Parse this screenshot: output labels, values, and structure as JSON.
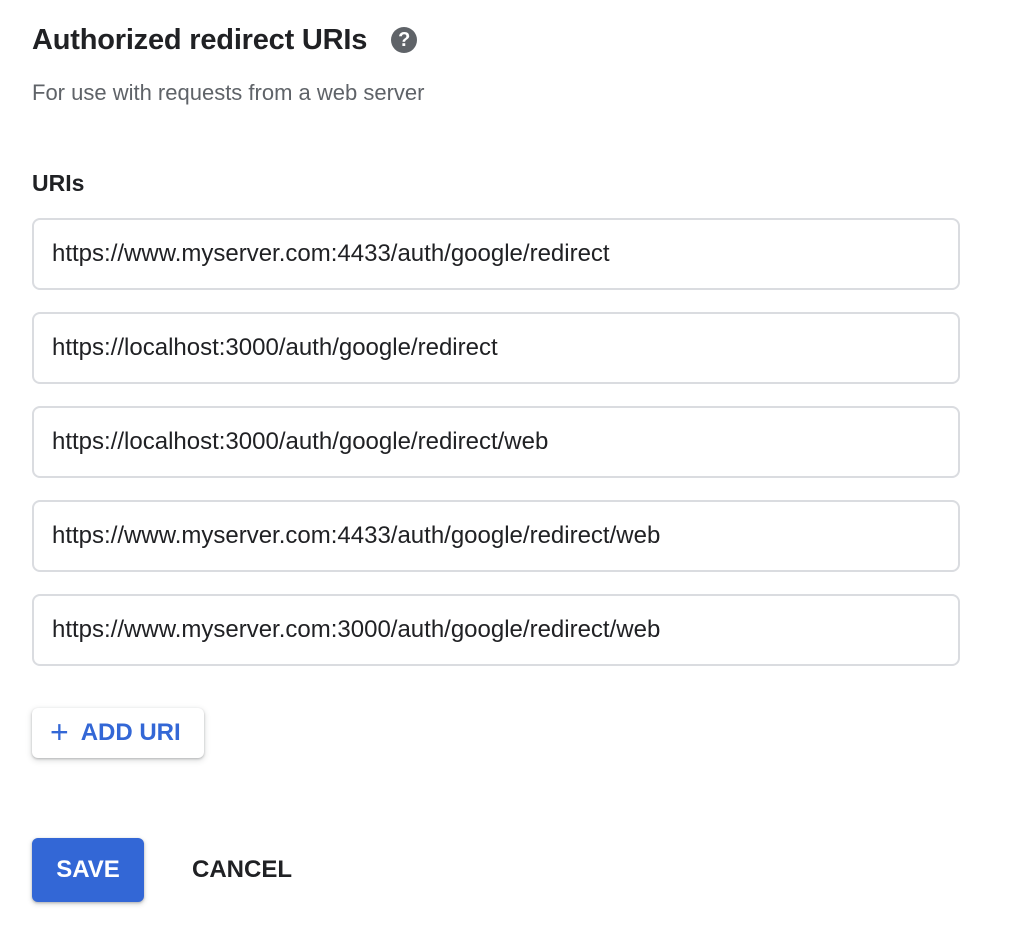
{
  "section": {
    "title": "Authorized redirect URIs",
    "help_icon": "?",
    "subtitle": "For use with requests from a web server"
  },
  "uris": {
    "label": "URIs",
    "values": [
      "https://www.myserver.com:4433/auth/google/redirect",
      "https://localhost:3000/auth/google/redirect",
      "https://localhost:3000/auth/google/redirect/web",
      "https://www.myserver.com:4433/auth/google/redirect/web",
      "https://www.myserver.com:3000/auth/google/redirect/web"
    ]
  },
  "actions": {
    "add_uri_icon": "+",
    "add_uri_label": "ADD URI",
    "save_label": "SAVE",
    "cancel_label": "CANCEL"
  },
  "colors": {
    "accent": "#3367d6",
    "text": "#202124",
    "secondary_text": "#5f6368",
    "border": "#dadce0"
  }
}
